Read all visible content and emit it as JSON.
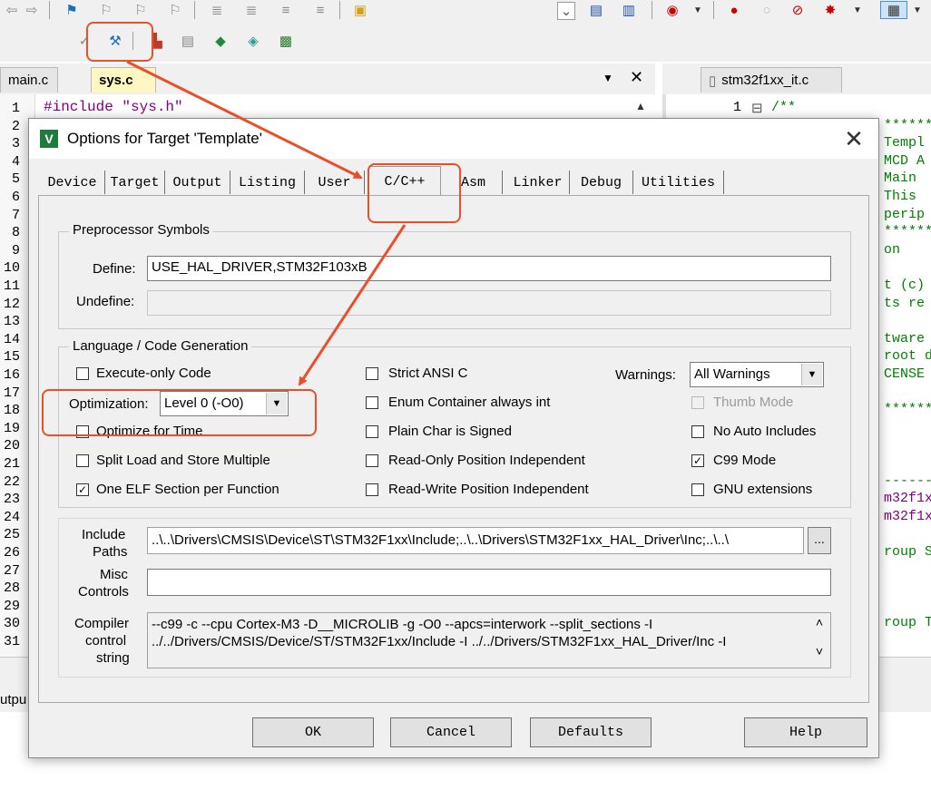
{
  "editor": {
    "tabs_left": [
      "main.c",
      "sys.c"
    ],
    "tab_right": "stm32f1xx_it.c",
    "code_line1": "#include \"sys.h\"",
    "line_numbers": [
      "1",
      "2",
      "3",
      "4",
      "5",
      "6",
      "7",
      "8",
      "9",
      "10",
      "11",
      "12",
      "13",
      "14",
      "15",
      "16",
      "17",
      "18",
      "19",
      "20",
      "21",
      "22",
      "23",
      "24",
      "25",
      "26",
      "27",
      "28",
      "29",
      "30",
      "31"
    ],
    "right_first_line_number": "1",
    "right_lines": [
      "/**",
      "*******",
      "Templ",
      "MCD A",
      "Main",
      "This",
      "perip",
      "*******",
      "on",
      "",
      "t (c)",
      "ts re",
      "",
      "tware",
      "root di",
      "CENSE",
      "",
      "*******",
      "",
      "",
      "",
      "------",
      "m32f1x",
      "m32f1x",
      "",
      "roup S",
      "",
      "",
      "",
      "roup T",
      ""
    ],
    "output_label": "utpu"
  },
  "dialog": {
    "title": "Options for Target 'Template'",
    "tabs": [
      "Device",
      "Target",
      "Output",
      "Listing",
      "User",
      "C/C++",
      "Asm",
      "Linker",
      "Debug",
      "Utilities"
    ],
    "active_tab": "C/C++",
    "preprocessor": {
      "group_label": "Preprocessor Symbols",
      "define_label": "Define:",
      "define_value": "USE_HAL_DRIVER,STM32F103xB",
      "undefine_label": "Undefine:",
      "undefine_value": ""
    },
    "language": {
      "group_label": "Language / Code Generation",
      "execute_only": {
        "label": "Execute-only Code",
        "checked": false
      },
      "optimization_label": "Optimization:",
      "optimization_value": "Level 0 (-O0)",
      "optimize_time": {
        "label": "Optimize for Time",
        "checked": false
      },
      "split_load": {
        "label": "Split Load and Store Multiple",
        "checked": false
      },
      "one_elf": {
        "label": "One ELF Section per Function",
        "checked": true
      },
      "strict_ansi": {
        "label": "Strict ANSI C",
        "checked": false
      },
      "enum_container": {
        "label": "Enum Container always int",
        "checked": false
      },
      "plain_char": {
        "label": "Plain Char is Signed",
        "checked": false
      },
      "ro_pi": {
        "label": "Read-Only Position Independent",
        "checked": false
      },
      "rw_pi": {
        "label": "Read-Write Position Independent",
        "checked": false
      },
      "warnings_label": "Warnings:",
      "warnings_value": "All Warnings",
      "thumb_mode": {
        "label": "Thumb Mode",
        "checked": false,
        "disabled": true
      },
      "no_auto_includes": {
        "label": "No Auto Includes",
        "checked": false
      },
      "c99_mode": {
        "label": "C99 Mode",
        "checked": true
      },
      "gnu_ext": {
        "label": "GNU extensions",
        "checked": false
      }
    },
    "include_paths_label_1": "Include",
    "include_paths_label_2": "Paths",
    "include_paths_value": "..\\..\\Drivers\\CMSIS\\Device\\ST\\STM32F1xx\\Include;..\\..\\Drivers\\STM32F1xx_HAL_Driver\\Inc;..\\..\\",
    "browse_label": "...",
    "misc_label_1": "Misc",
    "misc_label_2": "Controls",
    "misc_value": "",
    "compiler_label_1": "Compiler",
    "compiler_label_2": "control",
    "compiler_label_3": "string",
    "compiler_line_1": "--c99 -c --cpu Cortex-M3 -D__MICROLIB -g -O0 --apcs=interwork --split_sections -I",
    "compiler_line_2": "../../Drivers/CMSIS/Device/ST/STM32F1xx/Include -I ../../Drivers/STM32F1xx_HAL_Driver/Inc -I",
    "buttons": {
      "ok": "OK",
      "cancel": "Cancel",
      "defaults": "Defaults",
      "help": "Help"
    }
  },
  "colors": {
    "annotation_red": "#e8502c",
    "code_green": "#008000",
    "code_purple": "#800080"
  }
}
